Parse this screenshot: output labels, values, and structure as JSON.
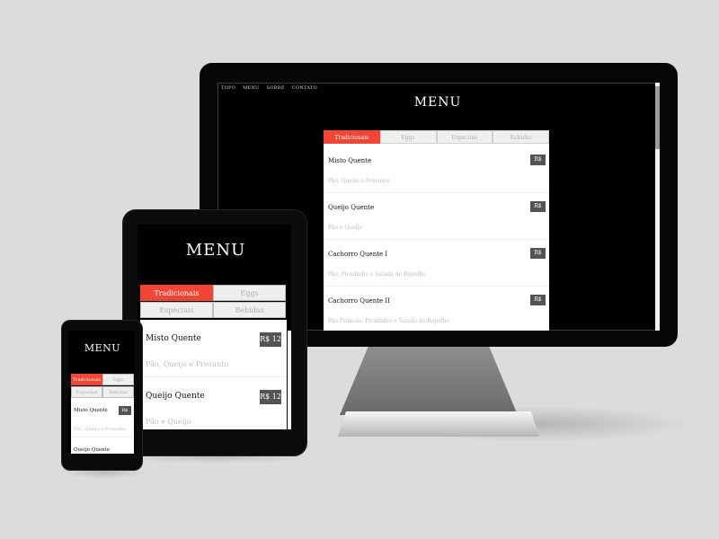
{
  "colors": {
    "accent": "#f14535",
    "price_badge": "#545454",
    "background": "#dcdcdc"
  },
  "desktop": {
    "nav": [
      "TOPO",
      "MENU",
      "SOBRE",
      "CONTATO"
    ],
    "title": "MENU",
    "tabs": [
      "Tradicionais",
      "Eggs",
      "Especiais",
      "Bebidas"
    ],
    "items": [
      {
        "name": "Misto Quente",
        "desc": "Pão, Queijo e Presunto",
        "price": "R$ 12"
      },
      {
        "name": "Queijo Quente",
        "desc": "Pão e Queijo",
        "price": "R$ 12"
      },
      {
        "name": "Cachorro Quente I",
        "desc": "Pão, Picadinho e Salada de Repolho",
        "price": "R$ 10"
      },
      {
        "name": "Cachorro Quente II",
        "desc": "Pão Francês, Picadinho e Salada de Repolho",
        "price": "R$ 11"
      }
    ]
  },
  "tablet": {
    "title": "MENU",
    "tabs": [
      "Tradicionais",
      "Eggs",
      "Especiais",
      "Bebidas"
    ],
    "items": [
      {
        "name": "Misto Quente",
        "desc": "Pão, Queijo e Presunto",
        "price": "R$ 12"
      },
      {
        "name": "Queijo Quente",
        "desc": "Pão e Queijo",
        "price": "R$ 12"
      }
    ]
  },
  "phone": {
    "title": "MENU",
    "tabs": [
      "Tradicionais",
      "Eggs",
      "Especiais",
      "Bebidas"
    ],
    "items": [
      {
        "name": "Misto Quente",
        "desc": "Pão, Queijo e Presunto",
        "price": "R$ 12"
      },
      {
        "name": "Queijo Quente",
        "desc": "",
        "price": ""
      }
    ]
  }
}
